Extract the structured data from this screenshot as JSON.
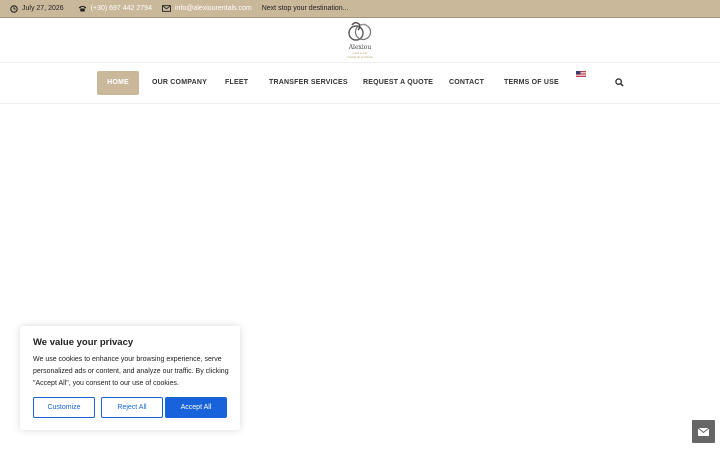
{
  "topbar": {
    "date": "July 27, 2026",
    "phone": "(+30) 697 442 2794",
    "email": "info@alexiourentals.com",
    "tagline": "Next stop your destination..."
  },
  "logo": {
    "brand": "Alexiou",
    "subline1": "rent a car",
    "subline2": "travel & tourism"
  },
  "nav": {
    "items": [
      "HOME",
      "OUR COMPANY",
      "FLEET",
      "TRANSFER SERVICES",
      "REQUEST A QUOTE",
      "CONTACT",
      "TERMS OF USE"
    ],
    "active_index": 0
  },
  "cookie": {
    "title": "We value your privacy",
    "text": "We use cookies to enhance your browsing experience, serve personalized ads or content, and analyze our traffic. By clicking \"Accept All\", you consent to our use of cookies.",
    "customize": "Customize",
    "reject": "Reject All",
    "accept": "Accept All"
  },
  "colors": {
    "accent": "#c9b89a",
    "button_blue": "#1863dc"
  },
  "icons": [
    "clock-icon",
    "phone-icon",
    "mail-icon",
    "us-flag-icon",
    "search-icon",
    "envelope-icon"
  ]
}
